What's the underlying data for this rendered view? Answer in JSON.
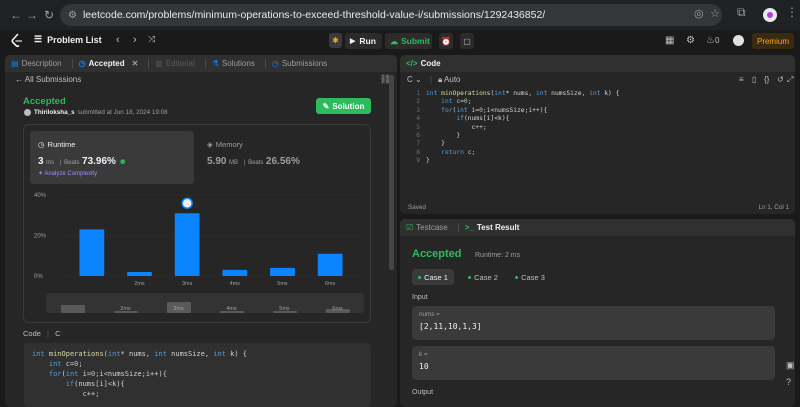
{
  "browser": {
    "url": "leetcode.com/problems/minimum-operations-to-exceed-threshold-value-i/submissions/1292436852/"
  },
  "toolbar": {
    "problem_list": "Problem List",
    "run": "Run",
    "submit": "Submit",
    "premium": "Premium",
    "streak": "0"
  },
  "left": {
    "tabs": [
      {
        "label": "Description"
      },
      {
        "label": "Accepted"
      },
      {
        "label": "Editorial"
      },
      {
        "label": "Solutions"
      },
      {
        "label": "Submissions"
      }
    ],
    "all_submissions": "All Submissions",
    "status": "Accepted",
    "author": "Thiriloksha_s",
    "submitted": "submitted at Jun 18, 2024 19:08",
    "solution_button": "Solution",
    "runtime": {
      "label": "Runtime",
      "value": "3",
      "unit": "ms",
      "beats_label": "Beats",
      "beats": "73.96%"
    },
    "memory": {
      "label": "Memory",
      "value": "5.90",
      "unit": "MB",
      "beats_label": "Beats",
      "beats": "26.56%"
    },
    "analyze": "Analyze Complexity",
    "code_header": "Code",
    "code_lang": "C",
    "code_lines": [
      "int minOperations(int* nums, int numsSize, int k) {",
      "    int c=0;",
      "    for(int i=0;i<numsSize;i++){",
      "        if(nums[i]<k){",
      "            c++;"
    ]
  },
  "chart_data": {
    "type": "bar",
    "categories": [
      "",
      "2ms",
      "3ms",
      "4ms",
      "5ms",
      "6ms"
    ],
    "values": [
      23,
      2,
      31,
      3,
      4,
      11
    ],
    "ylabel_ticks": [
      "40%",
      "20%",
      "0%"
    ],
    "ylim": [
      0,
      40
    ],
    "highlight_index": 2,
    "color": "#0a84ff",
    "scrubber_labels": [
      "2ms",
      "3ms",
      "4ms",
      "5ms",
      "6ms"
    ]
  },
  "code_panel": {
    "title": "Code",
    "lang": "C",
    "mode": "Auto",
    "lines": [
      "int minOperations(int* nums, int numsSize, int k) {",
      "    int c=0;",
      "    for(int i=0;i<numsSize;i++){",
      "        if(nums[i]<k){",
      "            c++;",
      "        }",
      "    }",
      "    return c;",
      "}"
    ],
    "line_numbers": [
      "1",
      "2",
      "3",
      "4",
      "5",
      "6",
      "7",
      "8",
      "9"
    ],
    "saved": "Saved",
    "cursor": "Ln 1, Col 1"
  },
  "test": {
    "tabs": [
      {
        "label": "Testcase"
      },
      {
        "label": "Test Result"
      }
    ],
    "status": "Accepted",
    "runtime": "Runtime: 2 ms",
    "cases": [
      "Case 1",
      "Case 2",
      "Case 3"
    ],
    "input_label": "Input",
    "nums_label": "nums =",
    "nums_value": "[2,11,10,1,3]",
    "k_label": "k =",
    "k_value": "10",
    "output_label": "Output"
  }
}
